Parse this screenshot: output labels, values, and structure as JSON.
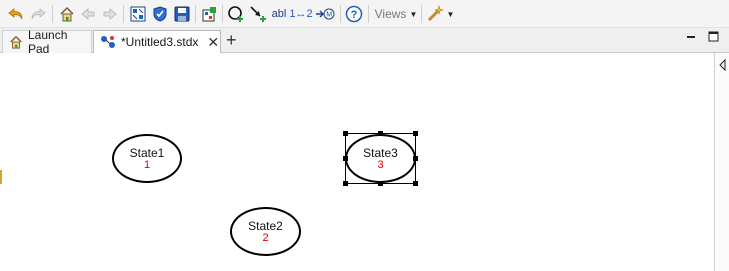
{
  "toolbar": {
    "views_label": "Views",
    "text_tool_label": "abl",
    "number_tool_label": "1↔2",
    "colors": {
      "accent_green": "#2e9e3a",
      "accent_blue": "#2060c0",
      "help_blue": "#1f5fbf"
    },
    "icons": [
      "undo-icon",
      "redo-icon",
      "home-icon",
      "back-icon",
      "forward-icon",
      "grid-icon",
      "shield-icon",
      "save-icon",
      "layout-icon",
      "add-state-icon",
      "add-transition-icon",
      "text-tool-icon",
      "number-tool-icon",
      "order-icon",
      "help-icon",
      "views-icon",
      "wand-icon"
    ]
  },
  "tabs": [
    {
      "label": "Launch Pad",
      "icon": "home-icon",
      "active": false
    },
    {
      "label": "*Untitled3.stdx",
      "icon": "diagram-icon",
      "active": true,
      "close": "✕"
    }
  ],
  "new_tab": "+",
  "diagram": {
    "states": [
      {
        "name": "State1",
        "number": "1",
        "selected": false
      },
      {
        "name": "State3",
        "number": "3",
        "selected": true
      },
      {
        "name": "State2",
        "number": "2",
        "selected": false
      }
    ],
    "number_color": "#e00000"
  }
}
